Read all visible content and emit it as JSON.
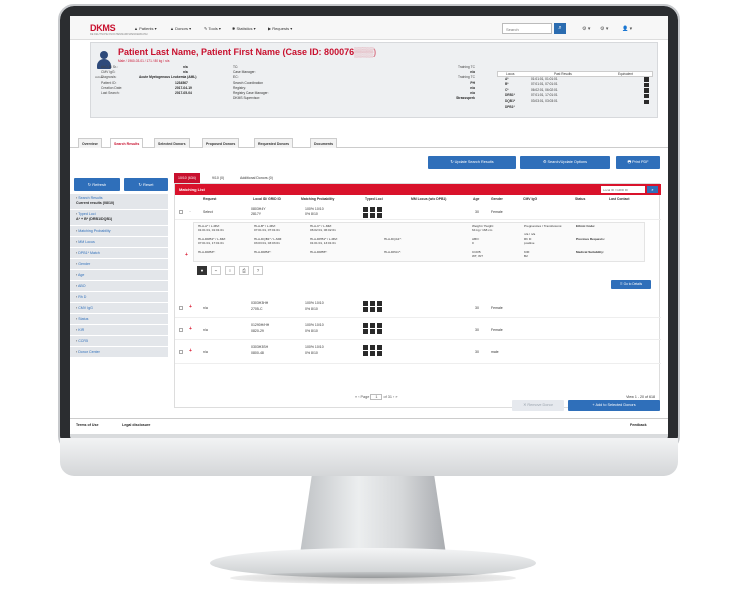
{
  "app": {
    "logo": "DKMS",
    "logo_sub": "DE DEUTSCHE KNOCHENMARKSPENDERDATEI",
    "nav": [
      "Patients",
      "Donors",
      "Tools",
      "Statistics",
      "Requests"
    ],
    "search_placeholder": "Search",
    "search_icon": "search-icon",
    "tool_icons": [
      "settings-icon",
      "settings-icon",
      "user-icon"
    ]
  },
  "patient": {
    "title": "Patient Last Name, Patient First Name (Case ID: 800076",
    "subtitle": "Male / 1960-03-01 / 171 / 80 kg / n/a",
    "avatar_label": "Active",
    "info_left": [
      {
        "k": "AbO-ID Sr.:",
        "v": "n/a"
      },
      {
        "k": "CMV IgG:",
        "v": "n/a"
      },
      {
        "k": "Diagnosis:",
        "v": "Acute Myelogenous Leukemia (AML)"
      },
      {
        "k": "Patient ID:",
        "v": "1234567"
      },
      {
        "k": "Creation Date:",
        "v": "2017-04-19"
      },
      {
        "k": "Last Search:",
        "v": "2017-05-04"
      }
    ],
    "info_mid": [
      "TC:",
      "Case Manager:",
      "EC:",
      "Search Coordination",
      "Registry:",
      "Registry Case Manager:",
      "DKMS Supervisor:"
    ],
    "info_right": [
      {
        "k": "Training TC",
        "v": "n/a"
      },
      {
        "k": "",
        "v": "n/a"
      },
      {
        "k": "Training TC",
        "v": "n/a"
      },
      {
        "k": "",
        "v": "PH"
      },
      {
        "k": "",
        "v": "n/a"
      },
      {
        "k": "",
        "v": "n/a"
      },
      {
        "k": "",
        "v": "Strasssperk"
      }
    ],
    "hla_header": [
      "Locus",
      "Past Results",
      "Equivalent"
    ],
    "hla_rows": [
      {
        "locus": "A*",
        "val": "01:01:01, 01:01:01"
      },
      {
        "locus": "B*",
        "val": "07:01:01, 07:01:01"
      },
      {
        "locus": "C*",
        "val": "06:02:01, 06:02:01"
      },
      {
        "locus": "DRB1*",
        "val": "07:01:01, 17:01:01"
      },
      {
        "locus": "DQB1*",
        "val": "03:03:01, 03:03:01"
      },
      {
        "locus": "DPB1*",
        "val": ""
      }
    ]
  },
  "tabs": [
    "Overview",
    "Search Results",
    "Selected Donors",
    "Proposed Donors",
    "Requested Donors",
    "Documents"
  ],
  "actions": {
    "update": "Update Search Results",
    "search_update": "Search/Update Options",
    "print": "Print PDF"
  },
  "subtabs": [
    "10/10 (634)",
    "9/10 (0)",
    "Additional Donors (0)"
  ],
  "sidebar": {
    "refresh": "Refresh",
    "reset": "Reset",
    "items": [
      {
        "label": "Search Results",
        "sub": "Current results (08/10)"
      },
      {
        "label": "Typed Loci",
        "sub": "A* + B* (DRB1/DQB1)"
      },
      {
        "label": "Matching Probability",
        "sub": ""
      },
      {
        "label": "MM Locus",
        "sub": ""
      },
      {
        "label": "DPB1* Match",
        "sub": ""
      },
      {
        "label": "Gender",
        "sub": ""
      },
      {
        "label": "Age",
        "sub": ""
      },
      {
        "label": "ABO",
        "sub": ""
      },
      {
        "label": "Rh D",
        "sub": ""
      },
      {
        "label": "CMV IgG",
        "sub": ""
      },
      {
        "label": "Status",
        "sub": ""
      },
      {
        "label": "KIR",
        "sub": ""
      },
      {
        "label": "CCR5",
        "sub": ""
      },
      {
        "label": "Donor Center",
        "sub": ""
      }
    ]
  },
  "matching": {
    "title": "Matching List",
    "search_placeholder": "Local ID / GRID ID",
    "columns": [
      "Request",
      "Local ID/ GRID ID",
      "Matching Probability",
      "Typed Loci",
      "MM Locus (w/o DPB1)",
      "Age",
      "Gender",
      "CMV IgG",
      "Status",
      "Last Contact"
    ],
    "rows": [
      {
        "request": "Select",
        "id": "0803H4Y",
        "id2": "2817Y",
        "prob": "100% 10/10",
        "prob2": "0%  8/10",
        "age": "30",
        "gender": "Female"
      },
      {
        "request": "n/a",
        "id": "0303H3HH",
        "id2": "2705-C",
        "prob": "100% 10/10",
        "prob2": "0%  8/10",
        "age": "30",
        "gender": "Female"
      },
      {
        "request": "n/a",
        "id": "01290H/HH",
        "id2": "0820-29",
        "prob": "100% 10/10",
        "prob2": "0%  8/10",
        "age": "30",
        "gender": "Female"
      },
      {
        "request": "n/a",
        "id": "0303H3SH",
        "id2": "0800-48",
        "prob": "100% 10/10",
        "prob2": "0%  8/10",
        "age": "30",
        "gender": "male"
      }
    ],
    "detail": {
      "row1": [
        "HLA-A* / L-MM:",
        "HLA-B* / L-MM:",
        "HLA-C* / L-MM:",
        "Weight / Height:",
        "Pregnancies / Transfusions:",
        "Ethnic Code:"
      ],
      "row1v": [
        "01:01:01, 01:01:01",
        "07:01:01, 07:01:01",
        "06:02:01, 06:02:01",
        "64 kg / 168 cm",
        "n/a / n/a",
        ""
      ],
      "row2": [
        "HLA-DRB1* / L-MM:",
        "HLA-DQB1* / L-MM:",
        "HLA-DPB1* / L-MM:",
        "HLA-DQA1*:",
        "ABO:",
        "Rh D:",
        "Previous Requests:"
      ],
      "row2v": [
        "07:01:01, 17:01:01",
        "03:03:01, 03:03:01",
        "01:01:01, 13:01:01",
        "",
        "0",
        "positive",
        ""
      ],
      "row3": [
        "HLA-DRB3*:",
        "HLA-DRB4*:",
        "HLA-DRB5*:",
        "HLA-DPA1*:",
        "CCR5:",
        "KIR:",
        "Medical Suitability:"
      ],
      "row3v": [
        "",
        "",
        "",
        "",
        "WT, WT",
        "B2",
        ""
      ],
      "go_details": "Go to Details"
    },
    "pager": {
      "page_label": "Page",
      "page": "1",
      "of": "of 31"
    },
    "view": "View 1 - 20 of 618"
  },
  "bottom_actions": {
    "remove": "Remove Donor",
    "add": "Add to Selected Donors"
  },
  "footer": {
    "terms": "Terms of Use",
    "legal": "Legal disclosure",
    "feedback": "Feedback"
  }
}
